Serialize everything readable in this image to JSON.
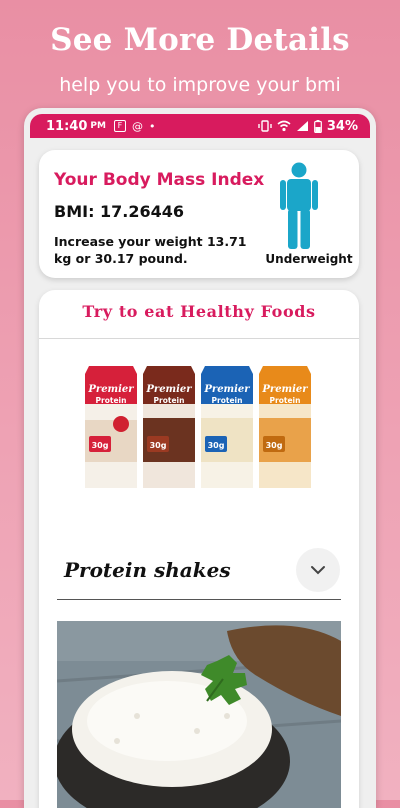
{
  "promo": {
    "title": "See More Details",
    "subtitle": "help you to improve your bmi"
  },
  "status_bar": {
    "time": "11:40",
    "ampm": "PM",
    "battery": "34%"
  },
  "bmi_card": {
    "title": "Your Body Mass Index",
    "bmi_text": "BMI: 17.26446",
    "advice": "Increase your weight 13.71 kg or 30.17 pound.",
    "category": "Underweight"
  },
  "food_card": {
    "title": "Try to eat Healthy Foods",
    "product_brand": "Premier",
    "product_sub": "Protein",
    "product_grams": "30g",
    "item_name": "Protein shakes"
  },
  "colors": {
    "accent": "#d81b5e",
    "figure": "#1ba6c9",
    "background": "#ec9cb0"
  }
}
